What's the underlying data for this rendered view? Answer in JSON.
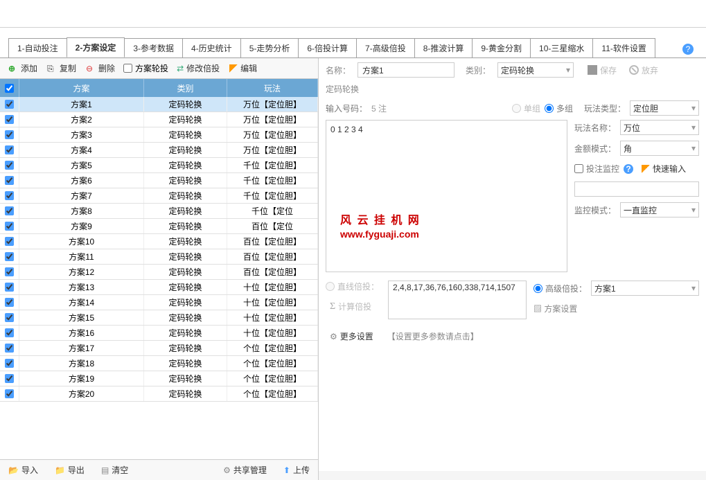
{
  "tabs": {
    "items": [
      {
        "label": "1-自动投注"
      },
      {
        "label": "2-方案设定"
      },
      {
        "label": "3-参考数据"
      },
      {
        "label": "4-历史统计"
      },
      {
        "label": "5-走势分析"
      },
      {
        "label": "6-倍投计算"
      },
      {
        "label": "7-高级倍投"
      },
      {
        "label": "8-推波计算"
      },
      {
        "label": "9-黄金分割"
      },
      {
        "label": "10-三星缩水"
      },
      {
        "label": "11-软件设置"
      }
    ],
    "active_index": 1
  },
  "toolbar": {
    "add": "添加",
    "copy": "复制",
    "delete": "删除",
    "rotate_chk": "方案轮投",
    "modify_mult": "修改倍投",
    "edit": "编辑"
  },
  "grid": {
    "headers": {
      "plan": "方案",
      "category": "类别",
      "play": "玩法"
    },
    "rows": [
      {
        "plan": "方案1",
        "cat": "定码轮换",
        "play": "万位【定位胆】",
        "selected": true
      },
      {
        "plan": "方案2",
        "cat": "定码轮换",
        "play": "万位【定位胆】"
      },
      {
        "plan": "方案3",
        "cat": "定码轮换",
        "play": "万位【定位胆】"
      },
      {
        "plan": "方案4",
        "cat": "定码轮换",
        "play": "万位【定位胆】"
      },
      {
        "plan": "方案5",
        "cat": "定码轮换",
        "play": "千位【定位胆】"
      },
      {
        "plan": "方案6",
        "cat": "定码轮换",
        "play": "千位【定位胆】"
      },
      {
        "plan": "方案7",
        "cat": "定码轮换",
        "play": "千位【定位胆】"
      },
      {
        "plan": "方案8",
        "cat": "定码轮换",
        "play": "千位【定位"
      },
      {
        "plan": "方案9",
        "cat": "定码轮换",
        "play": "百位【定位"
      },
      {
        "plan": "方案10",
        "cat": "定码轮换",
        "play": "百位【定位胆】"
      },
      {
        "plan": "方案11",
        "cat": "定码轮换",
        "play": "百位【定位胆】"
      },
      {
        "plan": "方案12",
        "cat": "定码轮换",
        "play": "百位【定位胆】"
      },
      {
        "plan": "方案13",
        "cat": "定码轮换",
        "play": "十位【定位胆】"
      },
      {
        "plan": "方案14",
        "cat": "定码轮换",
        "play": "十位【定位胆】"
      },
      {
        "plan": "方案15",
        "cat": "定码轮换",
        "play": "十位【定位胆】"
      },
      {
        "plan": "方案16",
        "cat": "定码轮换",
        "play": "十位【定位胆】"
      },
      {
        "plan": "方案17",
        "cat": "定码轮换",
        "play": "个位【定位胆】"
      },
      {
        "plan": "方案18",
        "cat": "定码轮换",
        "play": "个位【定位胆】"
      },
      {
        "plan": "方案19",
        "cat": "定码轮换",
        "play": "个位【定位胆】"
      },
      {
        "plan": "方案20",
        "cat": "定码轮换",
        "play": "个位【定位胆】"
      }
    ]
  },
  "footer": {
    "import": "导入",
    "export": "导出",
    "clear": "清空",
    "share": "共享管理",
    "upload": "上传"
  },
  "details": {
    "name_label": "名称：",
    "name_value": "方案1",
    "cat_label": "类别：",
    "cat_value": "定码轮换",
    "save": "保存",
    "discard": "放弃",
    "section": "定码轮换",
    "input_num_label": "输入号码：",
    "input_num_value": "5 注",
    "single": "单组",
    "multi": "多组",
    "play_type_label": "玩法类型：",
    "play_type_value": "定位胆",
    "numbers": "0 1 2 3 4",
    "play_name_label": "玩法名称：",
    "play_name_value": "万位",
    "amount_mode_label": "金额模式：",
    "amount_mode_value": "角",
    "bet_monitor": "投注监控",
    "quick_input": "快速输入",
    "monitor_mode_label": "监控模式：",
    "monitor_mode_value": "一直监控",
    "straight_mult": "直线倍投：",
    "straight_mult_value": "2,4,8,17,36,76,160,338,714,1507",
    "calc_mult": "计算倍投",
    "adv_mult": "高级倍投：",
    "adv_mult_value": "方案1",
    "plan_settings": "方案设置",
    "more_settings": "更多设置",
    "more_hint": "【设置更多参数请点击】"
  },
  "watermark": {
    "line1": "风 云 挂 机 网",
    "line2": "www.fyguaji.com"
  }
}
